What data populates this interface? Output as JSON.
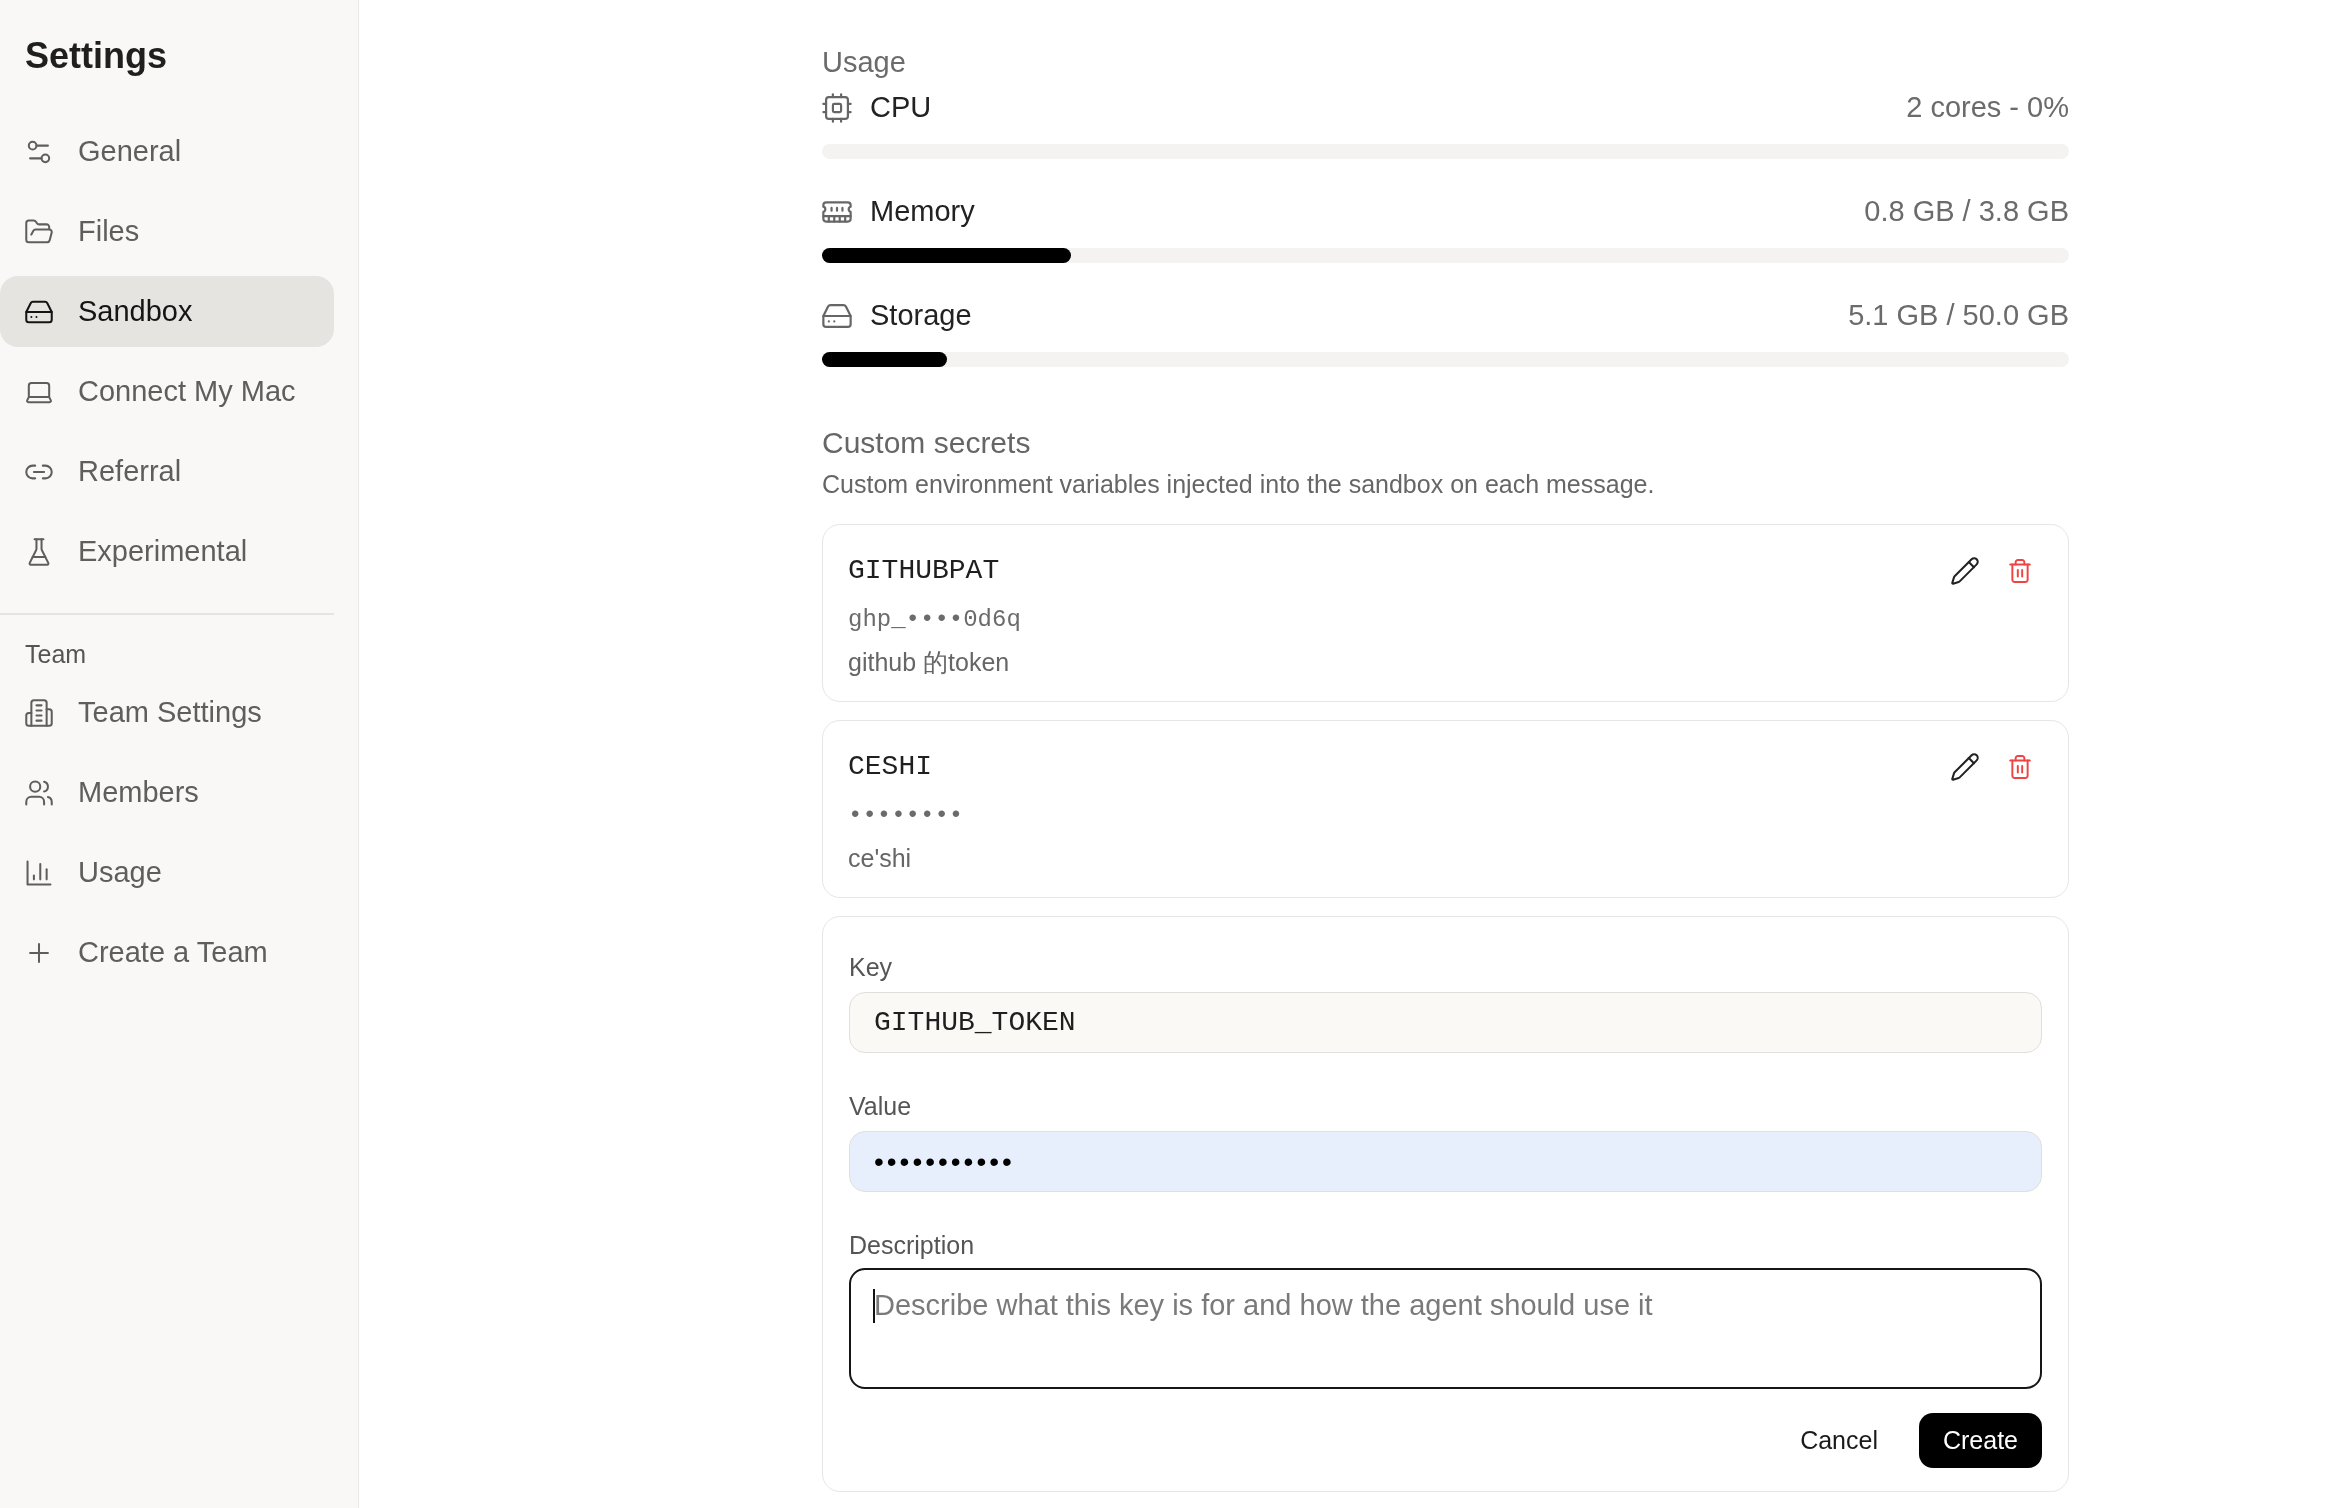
{
  "sidebar": {
    "title": "Settings",
    "items": [
      {
        "label": "General",
        "selected": false
      },
      {
        "label": "Files",
        "selected": false
      },
      {
        "label": "Sandbox",
        "selected": true
      },
      {
        "label": "Connect My Mac",
        "selected": false
      },
      {
        "label": "Referral",
        "selected": false
      },
      {
        "label": "Experimental",
        "selected": false
      }
    ],
    "sections": [
      {
        "heading": "Team",
        "items": [
          {
            "label": "Team Settings",
            "selected": false
          },
          {
            "label": "Members",
            "selected": false
          },
          {
            "label": "Usage",
            "selected": false
          },
          {
            "label": "Create a Team",
            "selected": false
          }
        ]
      }
    ]
  },
  "usage": {
    "heading": "Usage",
    "meters": [
      {
        "label": "CPU",
        "reading": "2 cores - 0%"
      },
      {
        "label": "Memory",
        "reading": "0.8 GB / 3.8 GB",
        "level": 0.2
      },
      {
        "label": "Storage",
        "reading": "5.1 GB / 50.0 GB",
        "level": 0.1
      }
    ]
  },
  "secrets": {
    "heading": "Custom secrets",
    "description": "Custom environment variables injected into the sandbox on each message.",
    "items": [
      {
        "key": "GITHUBPAT",
        "value": "ghp_••••0d6q",
        "description": "github 的token"
      },
      {
        "key": "CESHI",
        "value": "••••••••",
        "description": "ce'shi"
      }
    ]
  },
  "form": {
    "fields": [
      {
        "kind": "text",
        "label": "Key",
        "value": "GITHUB_TOKEN",
        "autofilled": false,
        "focused": false
      },
      {
        "kind": "password",
        "label": "Value",
        "value": "•••••••••••",
        "autofilled": true,
        "focused": false
      },
      {
        "kind": "textarea",
        "label": "Description",
        "placeholder": "Describe what this key is for and how the agent should use it",
        "autofilled": false,
        "focused": true
      }
    ],
    "buttons": [
      {
        "label": "Cancel",
        "kind": "secondary"
      },
      {
        "label": "Create",
        "kind": "primary"
      }
    ]
  }
}
